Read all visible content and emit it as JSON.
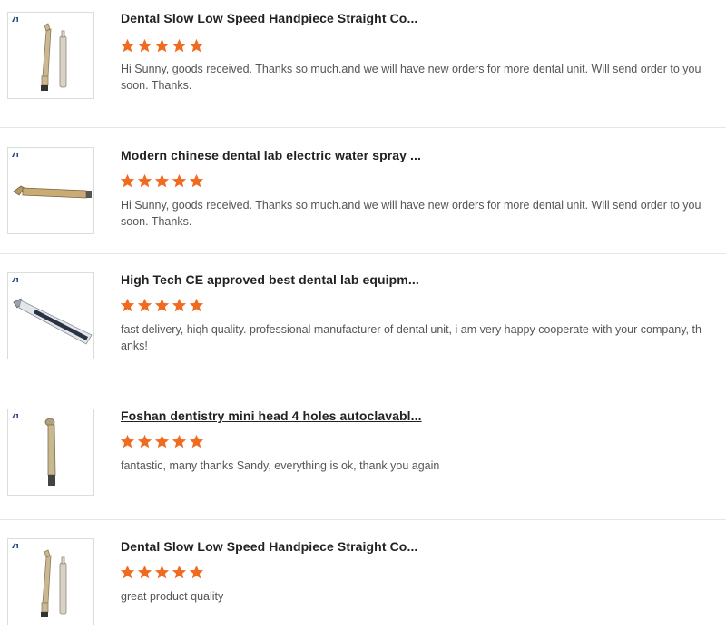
{
  "accent_star_color": "#f06a1f",
  "reviews": [
    {
      "product_title": "Dental Slow Low Speed Handpiece Straight Co...",
      "rating": 5,
      "comment": "Hi Sunny, goods received. Thanks so much.and we will have new orders for more dental unit. Will send order to you soon. Thanks.",
      "image_icon": "slow-speed-handpiece-set-image"
    },
    {
      "product_title": "Modern chinese dental lab electric water spray ...",
      "rating": 5,
      "comment": "Hi Sunny, goods received. Thanks so much.and we will have new orders for more dental unit. Will send order to you soon. Thanks.",
      "image_icon": "high-speed-handpiece-image"
    },
    {
      "product_title": "High Tech CE approved best dental lab equipm...",
      "rating": 5,
      "comment": "fast delivery, hiqh quality. professional manufacturer of dental unit, i am very happy cooperate with your company, thanks!",
      "image_icon": "contra-angle-handpiece-image"
    },
    {
      "product_title": "Foshan dentistry mini head 4 holes autoclavabl...",
      "rating": 5,
      "comment": "fantastic, many thanks Sandy, everything is ok, thank you again",
      "image_icon": "mini-head-handpiece-image"
    },
    {
      "product_title": "Dental Slow Low Speed Handpiece Straight Co...",
      "rating": 5,
      "comment": "great product quality",
      "image_icon": "slow-speed-handpiece-set-image"
    }
  ]
}
